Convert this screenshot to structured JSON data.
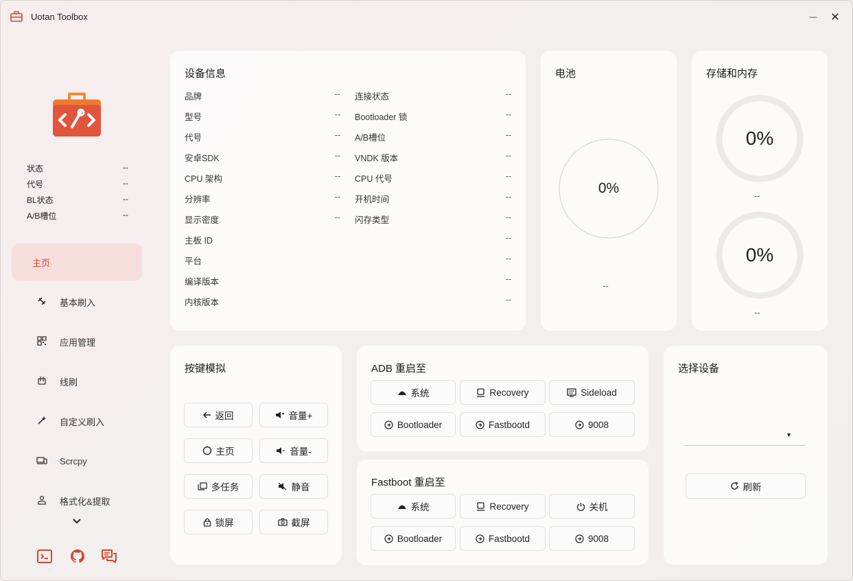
{
  "window": {
    "title": "Uotan Toolbox",
    "minimize_symbol": "—",
    "close_symbol": "✕"
  },
  "colors": {
    "accent": "#e2553d",
    "active_nav_bg": "#f6dedd",
    "active_nav_text": "#d9432f"
  },
  "sidebar": {
    "status": [
      {
        "label": "状态",
        "value": "--"
      },
      {
        "label": "代号",
        "value": "--"
      },
      {
        "label": "BL状态",
        "value": "--"
      },
      {
        "label": "A/B槽位",
        "value": "--"
      }
    ],
    "nav": [
      {
        "label": "主页",
        "icon": "home",
        "active": true
      },
      {
        "label": "基本刷入",
        "icon": "flash-icon"
      },
      {
        "label": "应用管理",
        "icon": "apps-grid-icon"
      },
      {
        "label": "线刷",
        "icon": "wired-flash-icon"
      },
      {
        "label": "自定义刷入",
        "icon": "magic-wand-icon"
      },
      {
        "label": "Scrcpy",
        "icon": "screen-mirror-icon"
      },
      {
        "label": "格式化&提取",
        "icon": "format-extract-icon"
      }
    ],
    "footer_icons": [
      "terminal-icon",
      "github-icon",
      "feedback-icon"
    ]
  },
  "device_info": {
    "title": "设备信息",
    "left": [
      {
        "label": "品牌",
        "value": "--"
      },
      {
        "label": "型号",
        "value": "--"
      },
      {
        "label": "代号",
        "value": "--"
      },
      {
        "label": "安卓SDK",
        "value": "--"
      },
      {
        "label": "CPU 架构",
        "value": "--"
      },
      {
        "label": "分辨率",
        "value": "--"
      },
      {
        "label": "显示密度",
        "value": "--"
      }
    ],
    "right": [
      {
        "label": "连接状态",
        "value": "--"
      },
      {
        "label": "Bootloader 锁",
        "value": "--"
      },
      {
        "label": "A/B槽位",
        "value": "--"
      },
      {
        "label": "VNDK 版本",
        "value": "--"
      },
      {
        "label": "CPU 代号",
        "value": "--"
      },
      {
        "label": "开机时间",
        "value": "--"
      },
      {
        "label": "闪存类型",
        "value": "--"
      }
    ],
    "full": [
      {
        "label": "主板 ID",
        "value": "--"
      },
      {
        "label": "平台",
        "value": "--"
      },
      {
        "label": "编译版本",
        "value": "--"
      },
      {
        "label": "内核版本",
        "value": "--"
      }
    ]
  },
  "battery": {
    "title": "电池",
    "percent_text": "0%",
    "level": 0,
    "detail": "--"
  },
  "storage": {
    "title": "存储和内存",
    "storage_percent_text": "0%",
    "storage_level": 0,
    "storage_detail": "--",
    "memory_percent_text": "0%",
    "memory_level": 0,
    "memory_detail": "--"
  },
  "keys": {
    "title": "按键模拟",
    "buttons": [
      {
        "label": "返回",
        "icon": "arrow-left-icon"
      },
      {
        "label": "音量+",
        "icon": "volume-up-icon"
      },
      {
        "label": "主页",
        "icon": "circle-home-icon"
      },
      {
        "label": "音量-",
        "icon": "volume-down-icon"
      },
      {
        "label": "多任务",
        "icon": "multitask-icon"
      },
      {
        "label": "静音",
        "icon": "mute-icon"
      },
      {
        "label": "锁屏",
        "icon": "lock-icon"
      },
      {
        "label": "截屏",
        "icon": "camera-icon"
      }
    ]
  },
  "adb_reboot": {
    "title": "ADB 重启至",
    "buttons": [
      {
        "label": "系统",
        "icon": "android-icon"
      },
      {
        "label": "Recovery",
        "icon": "recovery-icon"
      },
      {
        "label": "Sideload",
        "icon": "sideload-icon"
      },
      {
        "label": "Bootloader",
        "icon": "reboot-icon"
      },
      {
        "label": "Fastbootd",
        "icon": "reboot-icon"
      },
      {
        "label": "9008",
        "icon": "reboot-icon"
      }
    ]
  },
  "fastboot_reboot": {
    "title": "Fastboot 重启至",
    "buttons": [
      {
        "label": "系统",
        "icon": "android-icon"
      },
      {
        "label": "Recovery",
        "icon": "recovery-icon"
      },
      {
        "label": "关机",
        "icon": "power-icon"
      },
      {
        "label": "Bootloader",
        "icon": "reboot-icon"
      },
      {
        "label": "Fastbootd",
        "icon": "reboot-icon"
      },
      {
        "label": "9008",
        "icon": "reboot-icon"
      }
    ]
  },
  "select_device": {
    "title": "选择设备",
    "selected": "",
    "refresh_label": "刷新"
  }
}
